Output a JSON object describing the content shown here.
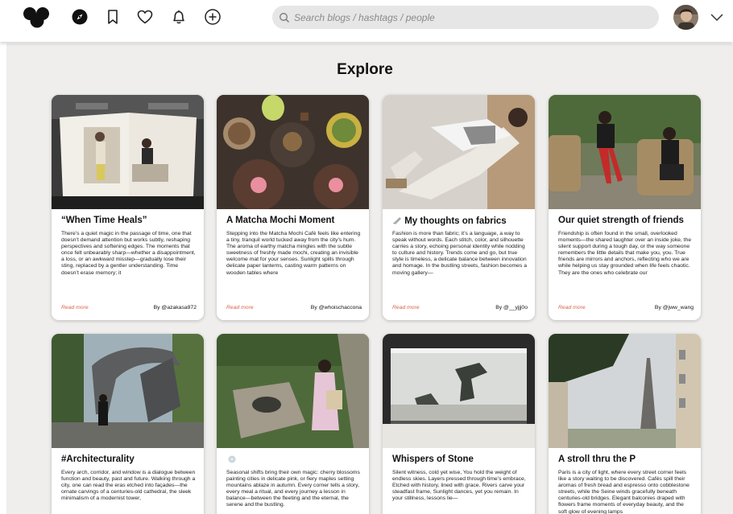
{
  "search": {
    "placeholder": "Search blogs / hashtags / people"
  },
  "page": {
    "title": "Explore"
  },
  "cards": [
    {
      "title": "“When Time Heals”",
      "body": "There’s a quiet magic in the passage of time, one that doesn’t demand attention but works subtly, reshaping perspectives and softening edges. The moments that once felt unbearably sharp—whether a disappointment, a loss, or an awkward misstep—gradually lose their sting, replaced by a gentler understanding. Time doesn’t erase memory; it",
      "read_more": "Read more",
      "byline": "By @azakasa972"
    },
    {
      "title": "A Matcha Mochi Moment",
      "body": "Stepping into the Matcha Mochi Café feels like entering a tiny, tranquil world tucked away from the city’s hum. The aroma of earthy matcha mingles with the subtle sweetness of freshly made mochi, creating an invisible welcome mat for your senses. Sunlight spills through delicate paper lanterns, casting warm patterns on wooden tables where",
      "read_more": "Read more",
      "byline": "By @whoischaccona"
    },
    {
      "title": "My thoughts on fabrics",
      "body": "Fashion is more than fabric; it’s a language, a way to speak without words. Each stitch, color, and silhouette carries a story, echoing personal identity while nodding to culture and history. Trends come and go, but true style is timeless, a delicate balance between innovation and homage. In the bustling streets, fashion becomes a moving gallery—",
      "read_more": "Read more",
      "byline": "By @__yjjj0o"
    },
    {
      "title": "Our quiet strength of friends",
      "body": "Friendship is often found in the small, overlooked moments—the shared laughter over an inside joke, the silent support during a tough day, or the way someone remembers the little details that make you, you. True friends are mirrors and anchors, reflecting who we are while helping us stay grounded when life feels chaotic. They are the ones who celebrate our",
      "read_more": "Read more",
      "byline": "By @jww_wang"
    },
    {
      "title": "#Architecturality",
      "body": "Every arch, corridor, and window is a dialogue between function and beauty, past and future. Walking through a city, one can read the eras etched into façades—the ornate carvings of a centuries-old cathedral, the sleek minimalism of a modernist tower,"
    },
    {
      "title": "",
      "body": "Seasonal shifts bring their own magic: cherry blossoms painting cities in delicate pink, or fiery maples setting mountains ablaze in autumn. Every corner tells a story, every meal a ritual, and every journey a lesson in balance—between the fleeting and the eternal, the serene and the bustling."
    },
    {
      "title": "Whispers of Stone",
      "body": "Silent witness, cold yet wise, You hold the weight of endless skies. Layers pressed through time’s embrace, Etched with history, lined with grace. Rivers carve your steadfast frame, Sunlight dances, yet you remain. In your stillness, lessons lie—"
    },
    {
      "title": "A stroll thru the P",
      "body": "Paris is a city of light, where every street corner feels like a story waiting to be discovered. Cafés spill their aromas of fresh bread and espresso onto cobblestone streets, while the Seine winds gracefully beneath centuries-old bridges. Elegant balconies draped with flowers frame moments of everyday beauty, and the soft glow of evening lamps"
    }
  ]
}
